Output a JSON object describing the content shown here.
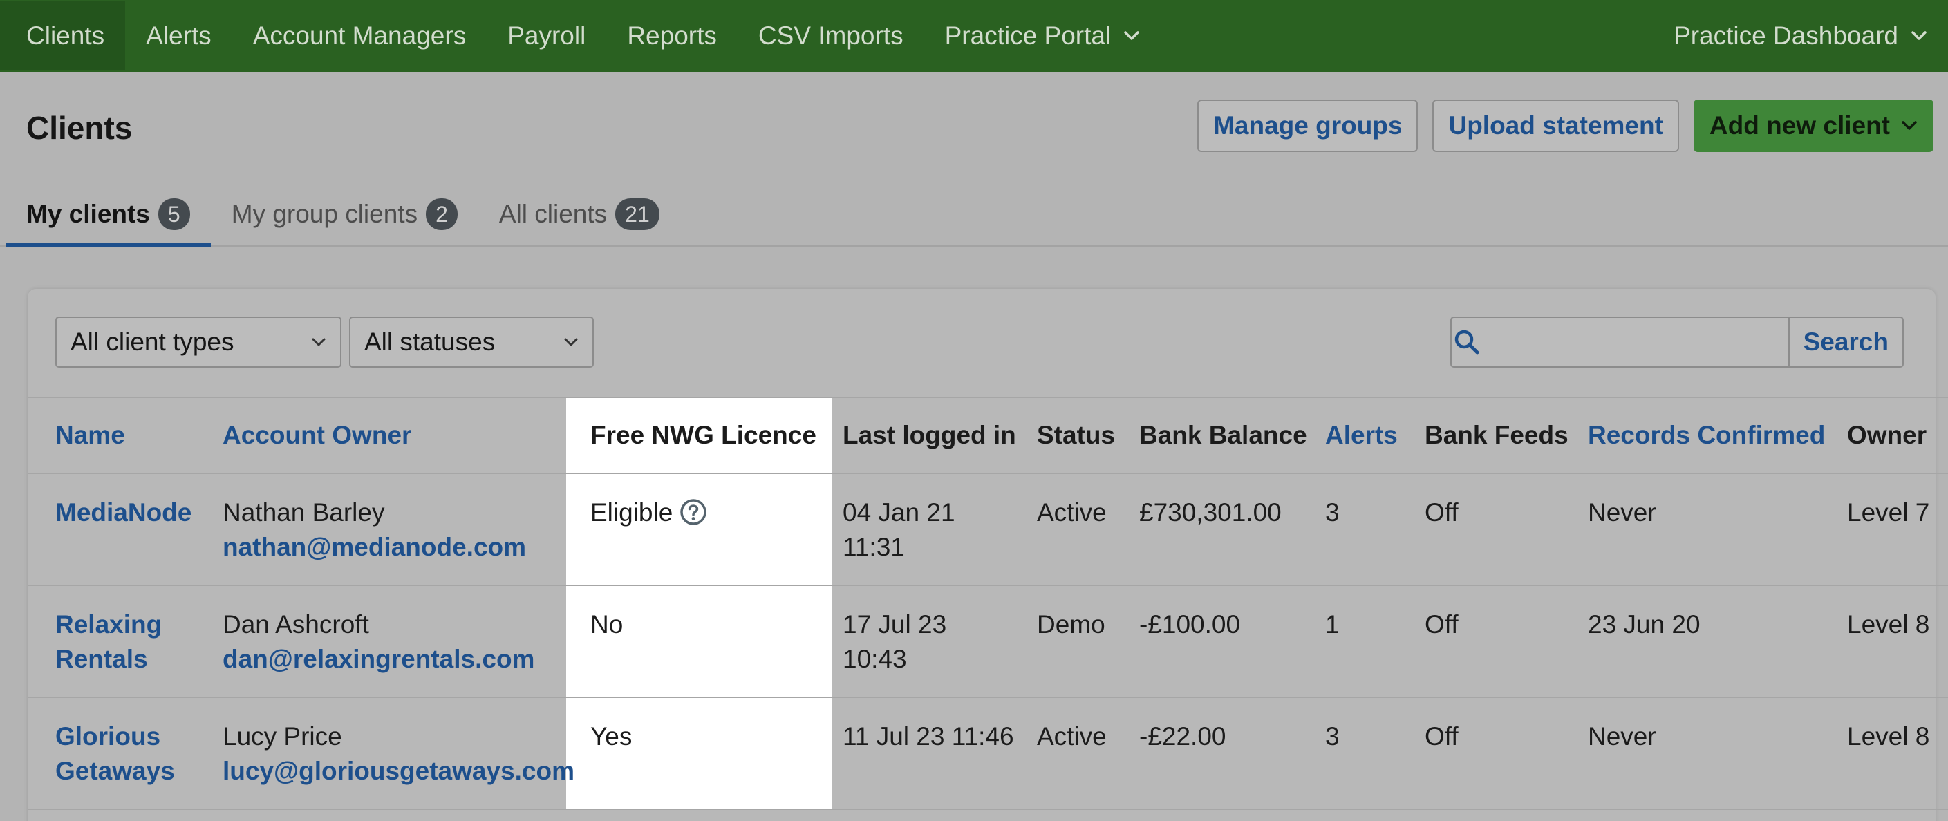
{
  "nav": {
    "items": [
      {
        "label": "Clients",
        "active": true
      },
      {
        "label": "Alerts"
      },
      {
        "label": "Account Managers"
      },
      {
        "label": "Payroll"
      },
      {
        "label": "Reports"
      },
      {
        "label": "CSV Imports"
      },
      {
        "label": "Practice Portal",
        "dropdown": true
      }
    ],
    "right": {
      "label": "Practice Dashboard",
      "dropdown": true
    },
    "color": "#2a6121"
  },
  "page": {
    "title": "Clients",
    "actions": {
      "manage_groups": "Manage groups",
      "upload_statement": "Upload statement",
      "add_new_client": "Add new client"
    }
  },
  "tabs": [
    {
      "label": "My clients",
      "count": "5",
      "active": true
    },
    {
      "label": "My group clients",
      "count": "2"
    },
    {
      "label": "All clients",
      "count": "21"
    }
  ],
  "filters": {
    "client_type": "All client types",
    "status": "All statuses",
    "search_placeholder": "",
    "search_button": "Search"
  },
  "table": {
    "headers": {
      "name": "Name",
      "account_owner": "Account Owner",
      "free_nwg_licence": "Free NWG Licence",
      "last_logged_in": "Last logged in",
      "status": "Status",
      "bank_balance": "Bank Balance",
      "alerts": "Alerts",
      "bank_feeds": "Bank Feeds",
      "records_confirmed": "Records Confirmed",
      "owner": "Owner"
    },
    "rows": [
      {
        "name_line1": "MediaNode",
        "name_line2": "",
        "owner_name": "Nathan Barley",
        "owner_email": "nathan@medianode.com",
        "licence": "Eligible",
        "last_logged_line1": "04 Jan 21",
        "last_logged_line2": "11:31",
        "status": "Active",
        "balance": "£730,301.00",
        "alerts": "3",
        "bank_feeds": "Off",
        "records_confirmed": "Never",
        "owner": "Level 7"
      },
      {
        "name_line1": "Relaxing",
        "name_line2": "Rentals",
        "owner_name": "Dan Ashcroft",
        "owner_email": "dan@relaxingrentals.com",
        "licence": "No",
        "last_logged_line1": "17 Jul 23",
        "last_logged_line2": "10:43",
        "status": "Demo",
        "balance": "-£100.00",
        "alerts": "1",
        "bank_feeds": "Off",
        "records_confirmed": "23 Jun 20",
        "owner": "Level 8"
      },
      {
        "name_line1": "Glorious",
        "name_line2": "Getaways",
        "owner_name": "Lucy Price",
        "owner_email": "lucy@gloriousgetaways.com",
        "licence": "Yes",
        "last_logged_line1": "11 Jul 23 11:46",
        "last_logged_line2": "",
        "status": "Active",
        "balance": "-£22.00",
        "alerts": "3",
        "bank_feeds": "Off",
        "records_confirmed": "Never",
        "owner": "Level 8"
      }
    ]
  },
  "icons": {
    "help": "question-circle-icon",
    "search": "magnifier-icon",
    "chevron": "chevron-down-icon"
  }
}
